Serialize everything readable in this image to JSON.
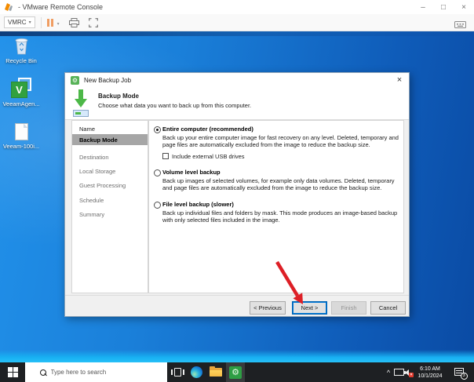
{
  "window": {
    "title": "- VMware Remote Console",
    "controls": {
      "minimize": "–",
      "maximize": "□",
      "close": "×"
    }
  },
  "toolbar": {
    "vmrc_label": "VMRC",
    "dropdown_caret": "▾",
    "icons": [
      "pause-icon",
      "printer-icon",
      "fullscreen-icon",
      "keyboard-icon"
    ]
  },
  "desktop": {
    "icons": [
      {
        "label": "Recycle Bin"
      },
      {
        "label": "VeeamAgen..."
      },
      {
        "label": "Veeam-100i..."
      }
    ]
  },
  "dialog": {
    "title": "New Backup Job",
    "close_glyph": "×",
    "header": {
      "title": "Backup Mode",
      "subtitle": "Choose what data you want to back up from this computer."
    },
    "steps": [
      {
        "label": "Name",
        "state": "visited"
      },
      {
        "label": "Backup Mode",
        "state": "selected"
      },
      {
        "label": "Destination",
        "state": "upcoming"
      },
      {
        "label": "Local Storage",
        "state": "upcoming"
      },
      {
        "label": "Guest Processing",
        "state": "upcoming"
      },
      {
        "label": "Schedule",
        "state": "upcoming"
      },
      {
        "label": "Summary",
        "state": "upcoming"
      }
    ],
    "options": [
      {
        "label": "Entire computer (recommended)",
        "desc": "Back up your entire computer image for fast recovery on any level. Deleted, temporary and page files are automatically excluded from the image to reduce the backup size.",
        "selected": true,
        "checkbox_label": "Include external USB drives",
        "checkbox_checked": false
      },
      {
        "label": "Volume level backup",
        "desc": "Back up images of selected volumes, for example only data volumes. Deleted, temporary and page files are automatically excluded from the image to reduce the backup size.",
        "selected": false
      },
      {
        "label": "File level backup (slower)",
        "desc": "Back up individual files and folders by mask. This mode produces an image-based backup with only selected files included in the image.",
        "selected": false
      }
    ],
    "buttons": {
      "previous": "< Previous",
      "next": "Next >",
      "finish": "Finish",
      "cancel": "Cancel",
      "finish_disabled": true
    }
  },
  "annotation": {
    "type": "red-arrow",
    "points_to": "next-button",
    "color": "#dd1f26"
  },
  "taskbar": {
    "search_placeholder": "Type here to search",
    "app_icons": [
      "task-view-icon",
      "edge-icon",
      "file-explorer-icon",
      "veeam-gear-icon"
    ],
    "tray": {
      "chevron": "^",
      "icons": [
        "network-icon",
        "volume-muted-icon"
      ],
      "time": "6:10 AM",
      "date": "10/1/2024",
      "notification_count": "3"
    }
  },
  "colors": {
    "accent_blue": "#0078d7",
    "veeam_green": "#31a13f",
    "arrow_red": "#dd1f26",
    "wallpaper_blue": "#1473cf",
    "taskbar_dark": "#1e2023"
  }
}
